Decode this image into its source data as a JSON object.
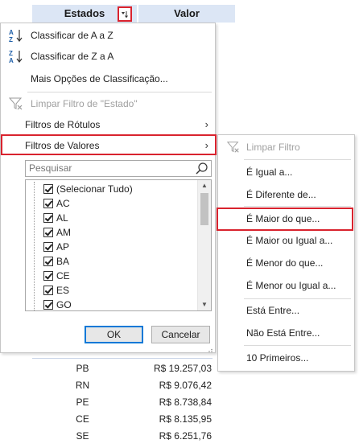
{
  "pivot_header": {
    "col_estados": "Estados",
    "col_valor": "Valor"
  },
  "menu": {
    "sort_asc": "Classificar de A a Z",
    "sort_desc": "Classificar de Z a A",
    "more_sort": "Mais Opções de Classificação...",
    "clear_filter": "Limpar Filtro de \"Estado\"",
    "label_filters": "Filtros de Rótulos",
    "value_filters": "Filtros de Valores",
    "search_placeholder": "Pesquisar",
    "list_items": [
      "(Selecionar Tudo)",
      "AC",
      "AL",
      "AM",
      "AP",
      "BA",
      "CE",
      "ES",
      "GO"
    ],
    "ok": "OK",
    "cancel": "Cancelar"
  },
  "submenu": {
    "clear": "Limpar Filtro",
    "equals": "É Igual a...",
    "not_equals": "É Diferente de...",
    "greater": "É Maior do que...",
    "greater_equal": "É Maior ou Igual a...",
    "less": "É Menor do que...",
    "less_equal": "É Menor ou Igual a...",
    "between": "Está Entre...",
    "not_between": "Não Está Entre...",
    "top10": "10 Primeiros..."
  },
  "rows": [
    {
      "state": "PB",
      "value": "R$ 19.257,03"
    },
    {
      "state": "RN",
      "value": "R$ 9.076,42"
    },
    {
      "state": "PE",
      "value": "R$ 8.738,84"
    },
    {
      "state": "CE",
      "value": "R$ 8.135,95"
    },
    {
      "state": "SE",
      "value": "R$ 6.251,76"
    }
  ],
  "colors": {
    "header_bg": "#dce6f5",
    "highlight": "#d9232e",
    "ok_border": "#0078d7"
  }
}
